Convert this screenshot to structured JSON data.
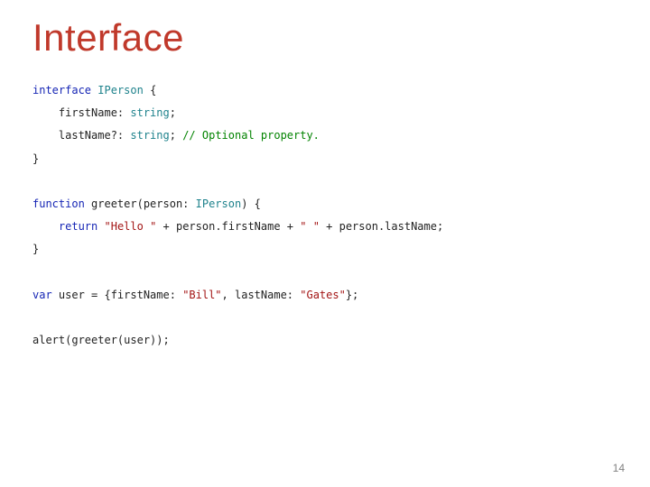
{
  "title": "Interface",
  "page_number": "14",
  "code": {
    "t": {
      "interface": "interface",
      "function": "function",
      "return": "return",
      "var": "var",
      "string": "string",
      "IPerson1": "IPerson",
      "IPerson2": "IPerson",
      "openBrace": " {",
      "closeBrace": "}",
      "firstNameDecl": "    firstName: ",
      "semi": ";",
      "lastNameDecl": "    lastName?: ",
      "optComment": " // Optional property.",
      "greeterSig1": " greeter(person: ",
      "greeterSig2": ") {",
      "retIndent": "    ",
      "retSpace": " ",
      "helloStr": "\"Hello \"",
      "plus1": " + person.firstName + ",
      "spaceStr": "\" \"",
      "plus2": " + person.lastName;",
      "userDecl": " user = {firstName: ",
      "billStr": "\"Bill\"",
      "commaLast": ", lastName: ",
      "gatesStr": "\"Gates\"",
      "userEnd": "};",
      "alertLine": "alert(greeter(user));"
    }
  }
}
